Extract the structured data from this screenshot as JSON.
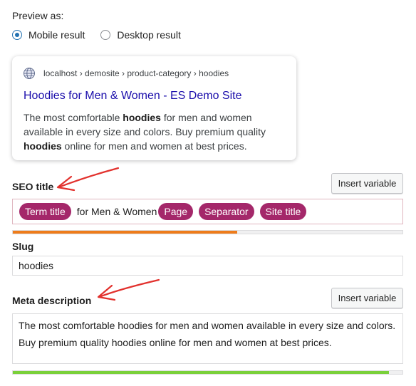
{
  "preview": {
    "label": "Preview as:",
    "options": [
      {
        "label": "Mobile result",
        "selected": true
      },
      {
        "label": "Desktop result",
        "selected": false
      }
    ]
  },
  "serp": {
    "icon": "globe-icon",
    "breadcrumb": "localhost › demosite › product-category › hoodies",
    "title": "Hoodies for Men & Women - ES Demo Site",
    "description_parts": [
      {
        "text": "The most comfortable ",
        "bold": false
      },
      {
        "text": "hoodies",
        "bold": true
      },
      {
        "text": " for men and women available in every size and colors. Buy premium quality ",
        "bold": false
      },
      {
        "text": "hoodies",
        "bold": true
      },
      {
        "text": " online for men and women at best prices.",
        "bold": false
      }
    ]
  },
  "seo_title": {
    "label": "SEO title",
    "insert_variable": "Insert variable",
    "parts": [
      {
        "type": "pill",
        "text": "Term title"
      },
      {
        "type": "text",
        "text": "for Men & Women"
      },
      {
        "type": "pill",
        "text": "Page"
      },
      {
        "type": "pill",
        "text": "Separator"
      },
      {
        "type": "pill",
        "text": "Site title"
      }
    ],
    "progress": 0.575,
    "progress_color": "#ee7c1b"
  },
  "slug": {
    "label": "Slug",
    "value": "hoodies"
  },
  "meta_description": {
    "label": "Meta description",
    "insert_variable": "Insert variable",
    "value": "The most comfortable hoodies for men and women available in every size and colors. Buy premium quality hoodies online for men and women at best prices.",
    "progress": 0.965,
    "progress_color": "#7ad03a"
  },
  "colors": {
    "accent": "#2271b1",
    "pill": "#a4286a",
    "link": "#1a0dab",
    "annotation_arrow": "#e2312d"
  }
}
